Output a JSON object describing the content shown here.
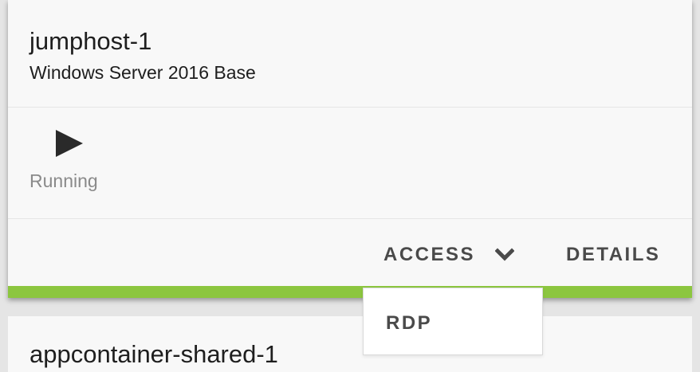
{
  "cards": [
    {
      "name": "jumphost-1",
      "image": "Windows Server 2016 Base",
      "status": {
        "icon": "play-icon",
        "label": "Running"
      },
      "actions": {
        "access_label": "ACCESS",
        "access_icon": "chevron-down-icon",
        "details_label": "DETAILS"
      },
      "accent_color": "#8cc63f"
    },
    {
      "name": "appcontainer-shared-1"
    }
  ],
  "access_menu": {
    "items": [
      {
        "label": "RDP"
      }
    ]
  }
}
